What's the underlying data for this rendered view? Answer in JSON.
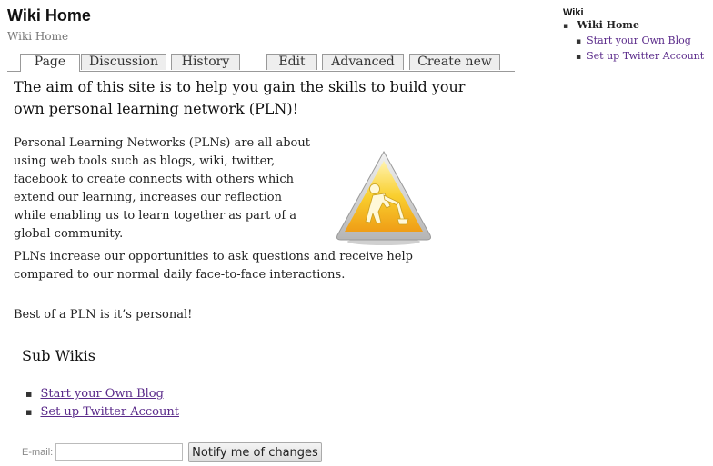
{
  "header": {
    "title": "Wiki Home",
    "breadcrumb": "Wiki Home"
  },
  "tabs": [
    {
      "label": "Page",
      "active": true
    },
    {
      "label": "Discussion"
    },
    {
      "label": "History"
    },
    {
      "label": "Edit"
    },
    {
      "label": "Advanced"
    },
    {
      "label": "Create new"
    }
  ],
  "content": {
    "intro": "The aim of this site is to help you gain the skills to build your own personal learning network (PLN)!",
    "paragraph1": "Personal Learning Networks (PLNs) are all about using web tools such as blogs, wiki, twitter, facebook to create connects with others which extend our learning, increases our reflection while enabling us to learn together as part of a global community.",
    "paragraph2": "PLNs increase our opportunities to ask questions and receive help compared to our normal daily face-to-face interactions.",
    "paragraph3": "Best of a PLN is it’s personal!",
    "image_icon": "under-construction-warning-icon",
    "subwikis_heading": "Sub Wikis",
    "subwikis": [
      {
        "label": "Start your Own Blog"
      },
      {
        "label": "Set up Twitter Account"
      }
    ]
  },
  "notify": {
    "email_label": "E-mail:",
    "email_value": "",
    "button_label": "Notify me of changes"
  },
  "sidebar": {
    "title": "Wiki",
    "current": "Wiki Home",
    "children": [
      {
        "label": "Start your Own Blog"
      },
      {
        "label": "Set up Twitter Account"
      }
    ]
  },
  "colors": {
    "link": "#5a2a8a",
    "warning_yellow": "#f5c518",
    "warning_orange": "#f0a020"
  }
}
